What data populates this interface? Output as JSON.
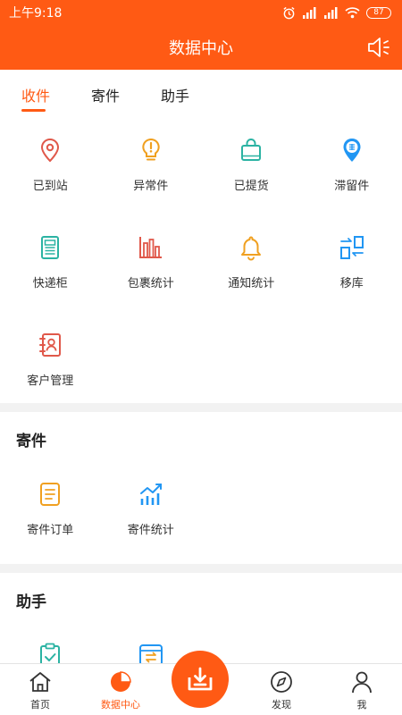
{
  "status_bar": {
    "time": "上午9:18",
    "battery": "87"
  },
  "header": {
    "title": "数据中心"
  },
  "tabs": [
    {
      "label": "收件",
      "active": true
    },
    {
      "label": "寄件",
      "active": false
    },
    {
      "label": "助手",
      "active": false
    }
  ],
  "receive_items": [
    {
      "label": "已到站",
      "icon": "location-pin-icon",
      "color": "#e0584a"
    },
    {
      "label": "异常件",
      "icon": "lightbulb-warning-icon",
      "color": "#f0a020"
    },
    {
      "label": "已提货",
      "icon": "shopping-bag-icon",
      "color": "#2bb3a3"
    },
    {
      "label": "滞留件",
      "icon": "stranded-pin-icon",
      "color": "#2196f3"
    },
    {
      "label": "快递柜",
      "icon": "locker-icon",
      "color": "#2bb3a3"
    },
    {
      "label": "包裹统计",
      "icon": "bar-chart-icon",
      "color": "#e0584a"
    },
    {
      "label": "通知统计",
      "icon": "bell-icon",
      "color": "#f0a020"
    },
    {
      "label": "移库",
      "icon": "transfer-icon",
      "color": "#2196f3"
    },
    {
      "label": "客户管理",
      "icon": "contact-book-icon",
      "color": "#e0584a"
    }
  ],
  "send_section": {
    "title": "寄件",
    "items": [
      {
        "label": "寄件订单",
        "icon": "order-doc-icon",
        "color": "#f0a020"
      },
      {
        "label": "寄件统计",
        "icon": "trend-chart-icon",
        "color": "#2196f3"
      }
    ]
  },
  "assistant_section": {
    "title": "助手",
    "items": [
      {
        "icon": "clipboard-check-icon",
        "color": "#2bb3a3"
      },
      {
        "icon": "box-exchange-icon",
        "color": "#2196f3"
      }
    ]
  },
  "bottom_nav": [
    {
      "label": "首页",
      "icon": "home-icon",
      "active": false
    },
    {
      "label": "数据中心",
      "icon": "pie-chart-icon",
      "active": true
    },
    {
      "label": "",
      "icon": "download-icon",
      "active": false
    },
    {
      "label": "发现",
      "icon": "compass-icon",
      "active": false
    },
    {
      "label": "我",
      "icon": "user-icon",
      "active": false
    }
  ],
  "colors": {
    "accent": "#ff5a14",
    "background": "#f2f2f2"
  }
}
